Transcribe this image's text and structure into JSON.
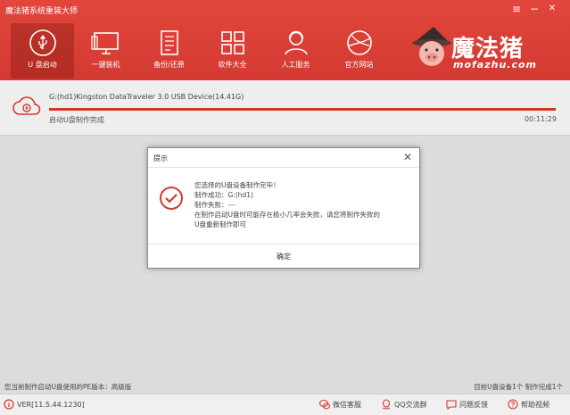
{
  "app": {
    "title": "魔法猪系统重装大师"
  },
  "window_controls": {
    "menu_icon": "hamburger-icon",
    "minimize_icon": "minimize-icon",
    "close_icon": "close-icon",
    "menu": "≡",
    "minimize": "−",
    "close": "✕"
  },
  "nav": [
    {
      "label": "U 盘启动",
      "icon": "usb-icon",
      "active": true
    },
    {
      "label": "一键装机",
      "icon": "monitor-icon",
      "active": false
    },
    {
      "label": "备份/还原",
      "icon": "backup-icon",
      "active": false
    },
    {
      "label": "软件大全",
      "icon": "apps-grid-icon",
      "active": false
    },
    {
      "label": "人工服务",
      "icon": "support-person-icon",
      "active": false
    },
    {
      "label": "官方网站",
      "icon": "globe-icon",
      "active": false
    }
  ],
  "brand": {
    "name": "魔法猪",
    "domain": "mofazhu.com"
  },
  "task": {
    "device": "G:(hd1)Kingston DataTraveler 3.0 USB Device(14.41G)",
    "status": "启动U盘制作完成",
    "time": "00:11:29",
    "progress": 1.0
  },
  "dialog": {
    "title": "提示",
    "lines": [
      "您选择的U盘设备制作完毕！",
      "制作成功：G:(hd1)",
      "制作失败：---",
      "在制作启动U盘时可能存在极小几率会失败，请您将制作失败的",
      "U盘重新制作即可"
    ],
    "ok": "确定",
    "close": "✕"
  },
  "status_bar": {
    "left": "您当前制作启动U盘使用的PE版本：高级版",
    "right": "目前U盘设备1个  制作完成1个"
  },
  "footer": {
    "version": "VER[11.5.44.1230]",
    "links": [
      "微信客服",
      "QQ交流群",
      "问题反馈",
      "帮助视频"
    ]
  },
  "colors": {
    "accent": "#d33a31",
    "header": "#e2463d"
  }
}
